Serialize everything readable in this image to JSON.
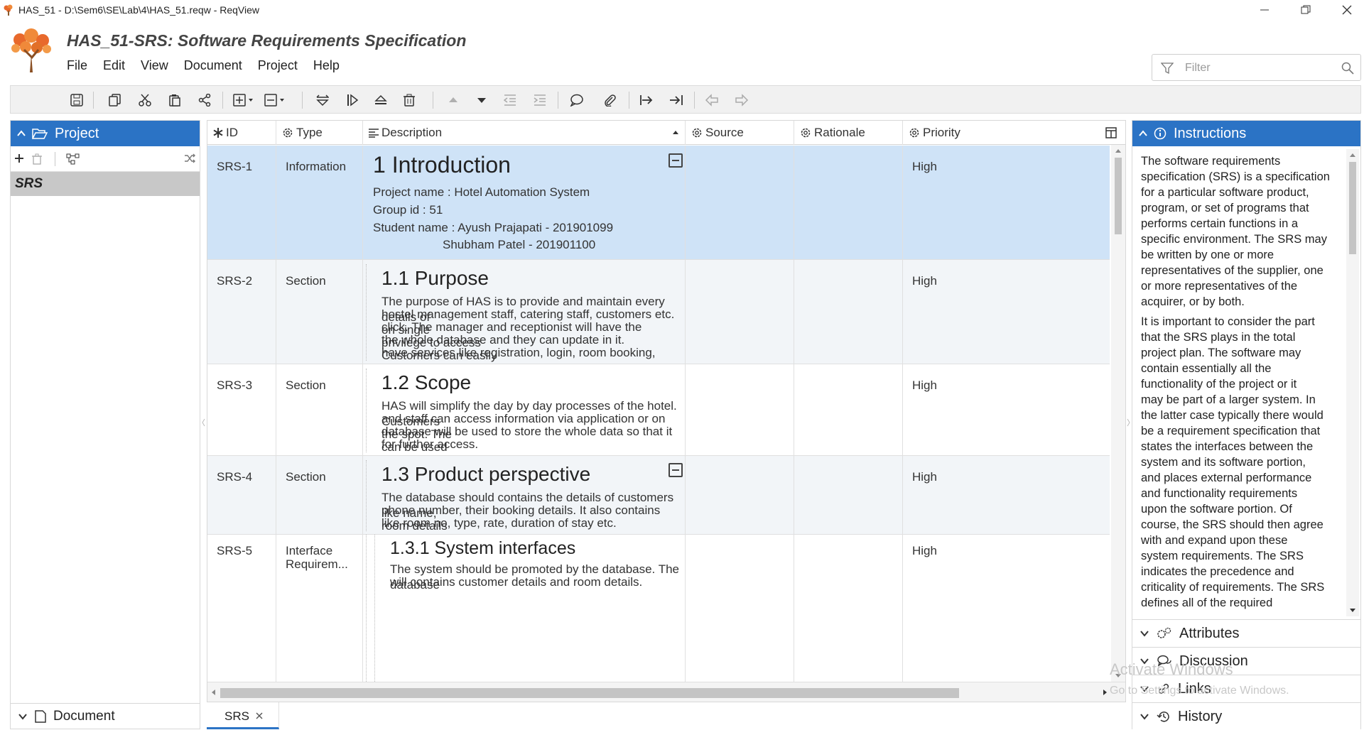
{
  "window": {
    "title": "HAS_51 - D:\\Sem6\\SE\\Lab\\4\\HAS_51.reqw - ReqView"
  },
  "header": {
    "doc_title": "HAS_51-SRS: Software Requirements Specification",
    "menu": [
      "File",
      "Edit",
      "View",
      "Document",
      "Project",
      "Help"
    ],
    "filter_placeholder": "Filter"
  },
  "left_panel": {
    "title": "Project",
    "selected_doc": "SRS",
    "bottom_section": "Document"
  },
  "grid": {
    "columns": [
      "ID",
      "Type",
      "Description",
      "Source",
      "Rationale",
      "Priority"
    ],
    "rows": [
      {
        "id": "SRS-1",
        "type": "Information",
        "heading": "1 Introduction",
        "lines": [
          "Project name : Hotel Automation System",
          "Group id : 51",
          "Student name : Ayush Prajapati - 201901099",
          "Shubham Patel - 201901100"
        ],
        "priority": "High"
      },
      {
        "id": "SRS-2",
        "type": "Section",
        "heading": "1.1 Purpose",
        "lines": [
          "The purpose of HAS is to provide and maintain every details of",
          "hostel management staff, catering staff, customers etc. on single",
          "click. The manager and receptionist will have the privilege to access",
          "the whole database and they can update in it. Customers can easily",
          "have services like registration, login, room booking, payment etc."
        ],
        "priority": "High"
      },
      {
        "id": "SRS-3",
        "type": "Section",
        "heading": "1.2 Scope",
        "lines": [
          "HAS will simplify the day by day processes of the hotel. Customers",
          "and staff can access information via application or on the spot. The",
          "database will be used to store the whole data so that it can be used",
          "for further access."
        ],
        "priority": "High"
      },
      {
        "id": "SRS-4",
        "type": "Section",
        "heading": "1.3 Product perspective",
        "lines": [
          "The database should contains the details of customers like name,",
          "phone number, their booking details. It also contains room details",
          "like room no, type, rate, duration of stay etc."
        ],
        "priority": "High"
      },
      {
        "id": "SRS-5",
        "type": "Interface Requirem...",
        "type_lines": [
          "Interface",
          "Requirem..."
        ],
        "heading": "1.3.1 System interfaces",
        "lines": [
          "The system should be promoted by the database. The database",
          "will contains customer details and room details."
        ],
        "priority": "High"
      }
    ]
  },
  "bottom_tab": "SRS",
  "right_panel": {
    "title": "Instructions",
    "paragraph1": [
      "The software requirements",
      "specification (SRS) is a specification",
      "for a particular software product,",
      "program, or set of programs that",
      "performs certain functions in a",
      "specific environment. The SRS may",
      "be written by one or more",
      "representatives of the supplier, one",
      "or more representatives of the",
      "acquirer, or by both."
    ],
    "paragraph2": [
      "It is important to consider the part",
      "that the SRS plays in the total",
      "project plan. The software may",
      "contain essentially all the",
      "functionality of the project or it",
      "may be part of a larger system. In",
      "the latter case typically there would",
      "be a requirement specification that",
      "states the interfaces between the",
      "system and its software portion,",
      "and places external performance",
      "and functionality requirements",
      "upon the software portion. Of",
      "course, the SRS should then agree",
      "with and expand upon these",
      "system requirements. The SRS",
      "indicates the precedence and",
      "criticality of requirements. The SRS",
      "defines all of the required"
    ],
    "sections": [
      "Attributes",
      "Discussion",
      "Links",
      "History"
    ]
  },
  "watermark": {
    "line1": "Activate Windows",
    "line2": "Go to Settings to activate Windows."
  },
  "colors": {
    "accent": "#2b73c5",
    "selected_row": "#cfe3f7",
    "alt_row": "#f2f5f8"
  }
}
